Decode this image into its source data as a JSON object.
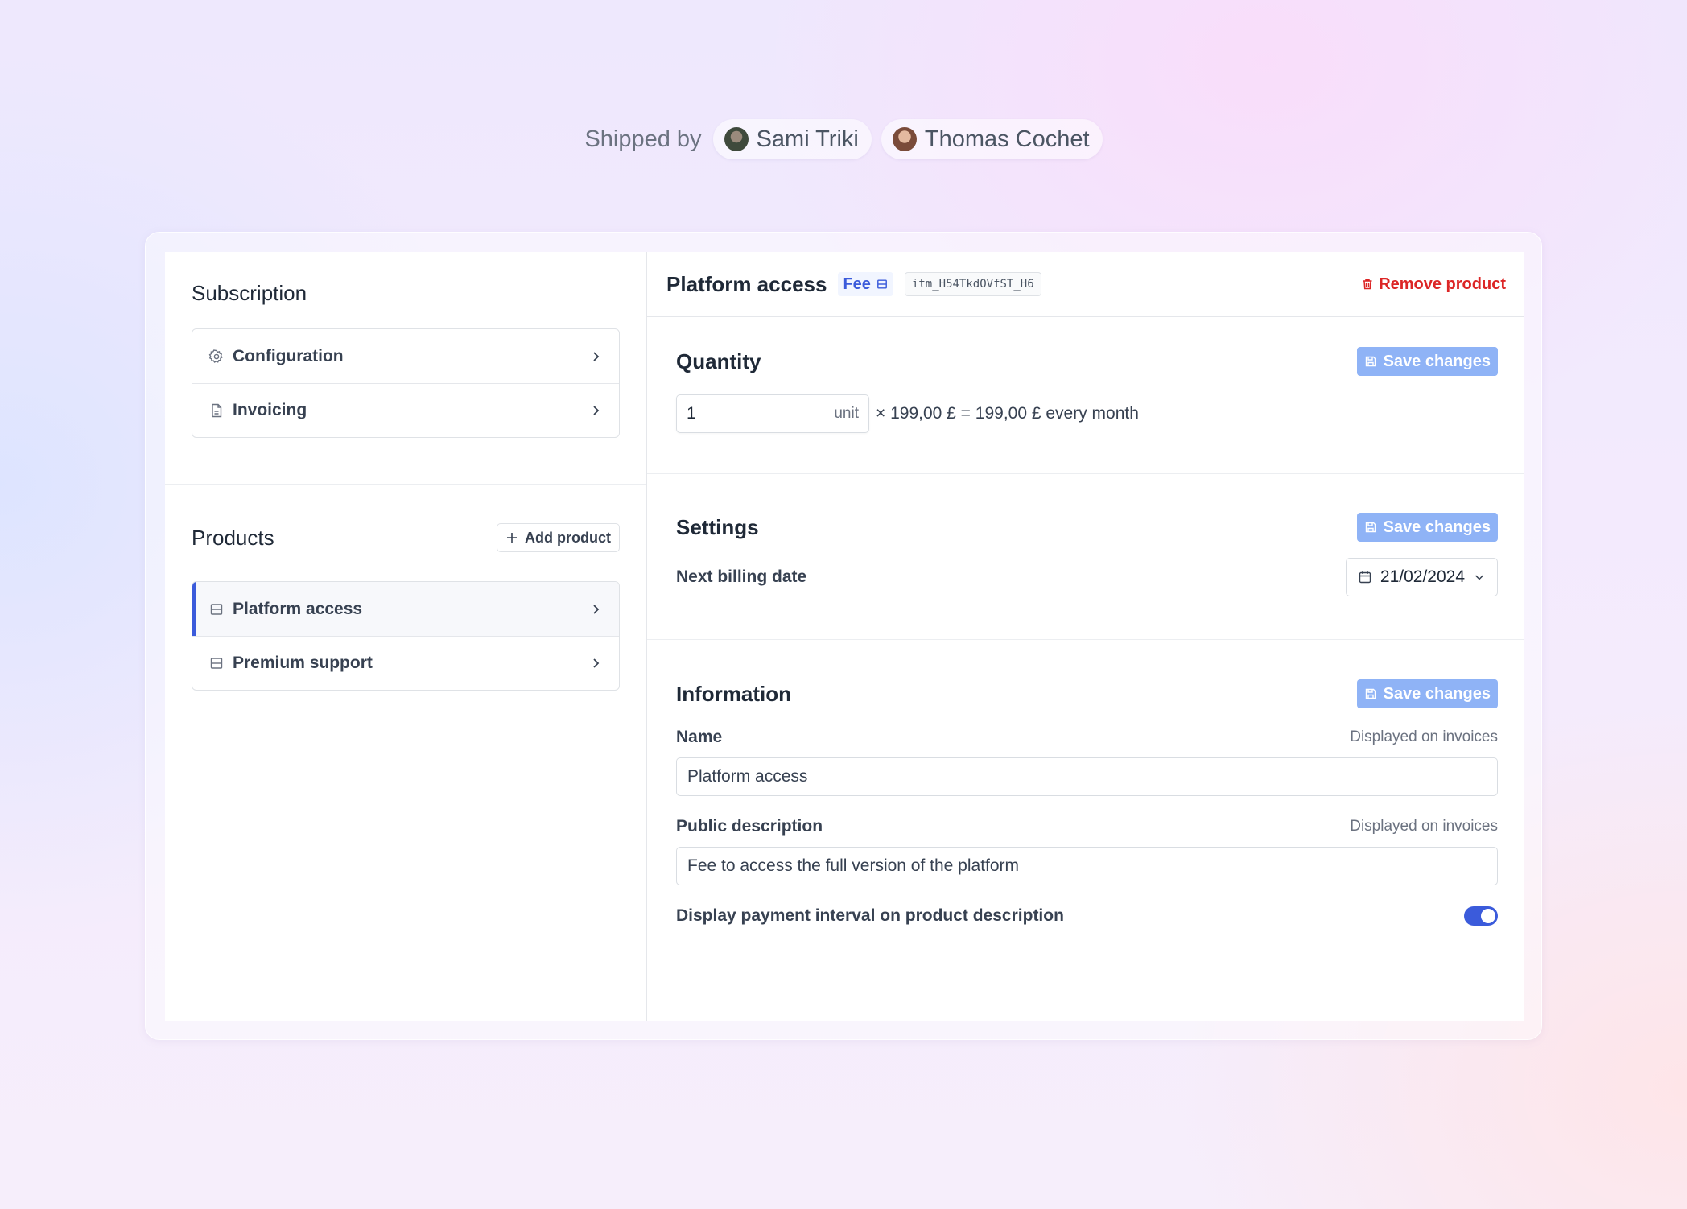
{
  "shipped": {
    "label": "Shipped by",
    "people": [
      {
        "name": "Sami Triki"
      },
      {
        "name": "Thomas Cochet"
      }
    ]
  },
  "subscription": {
    "title": "Subscription",
    "items": [
      {
        "label": "Configuration",
        "icon": "gear-icon"
      },
      {
        "label": "Invoicing",
        "icon": "document-icon"
      }
    ]
  },
  "products": {
    "title": "Products",
    "add_label": "Add product",
    "items": [
      {
        "label": "Platform access",
        "icon": "product-icon",
        "active": true
      },
      {
        "label": "Premium support",
        "icon": "product-icon",
        "active": false
      }
    ]
  },
  "detail": {
    "title": "Platform access",
    "badge": "Fee",
    "item_id": "itm_H54TkdOVfST_H6",
    "remove_label": "Remove product",
    "save_label": "Save changes",
    "quantity": {
      "title": "Quantity",
      "value": "1",
      "unit": "unit",
      "calc": "× 199,00 £ = 199,00 £ every month"
    },
    "settings": {
      "title": "Settings",
      "billing_label": "Next billing date",
      "billing_date": "21/02/2024"
    },
    "information": {
      "title": "Information",
      "name_label": "Name",
      "name_hint": "Displayed on invoices",
      "name_value": "Platform access",
      "desc_label": "Public description",
      "desc_hint": "Displayed on invoices",
      "desc_value": "Fee to access the full version of the platform",
      "toggle_label": "Display payment interval on product description",
      "toggle_on": true
    }
  },
  "colors": {
    "accent": "#3b5bdb",
    "danger": "#dc2626",
    "save_button": "#8fb3f6"
  }
}
